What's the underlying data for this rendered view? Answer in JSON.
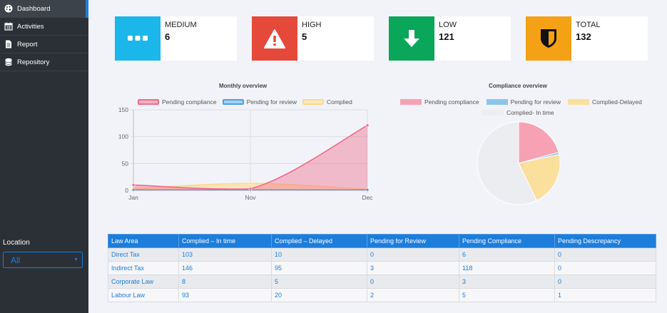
{
  "sidebar": {
    "items": [
      {
        "label": "Dashboard",
        "icon": "palette-icon",
        "active": true
      },
      {
        "label": "Activities",
        "icon": "calendar-icon",
        "active": false
      },
      {
        "label": "Report",
        "icon": "document-icon",
        "active": false
      },
      {
        "label": "Repository",
        "icon": "database-icon",
        "active": false
      }
    ],
    "location_label": "Location",
    "location_value": "All"
  },
  "cards": [
    {
      "label": "MEDIUM",
      "value": "6",
      "color": "#1bb7ea",
      "icon": "ellipsis-icon"
    },
    {
      "label": "HIGH",
      "value": "5",
      "color": "#e5493a",
      "icon": "warning-icon"
    },
    {
      "label": "LOW",
      "value": "121",
      "color": "#0aa65a",
      "icon": "arrow-down-icon"
    },
    {
      "label": "TOTAL",
      "value": "132",
      "color": "#f4a115",
      "icon": "shield-icon"
    }
  ],
  "monthly": {
    "title": "Monthly overview",
    "legend": [
      {
        "label": "Pending compliance",
        "color": "#f06b8c"
      },
      {
        "label": "Pending for review",
        "color": "#4aa1e6"
      },
      {
        "label": "Complied",
        "color": "#fcd98a"
      }
    ]
  },
  "compliance": {
    "title": "Compliance overview",
    "legend": [
      {
        "label": "Pending compliance",
        "color": "#f7a1b5"
      },
      {
        "label": "Pending for review",
        "color": "#8cc4ec"
      },
      {
        "label": "Complied-Delayed",
        "color": "#fadf9d"
      },
      {
        "label": "Complied- In time",
        "color": "#ebedf1"
      }
    ]
  },
  "chart_data": [
    {
      "type": "area",
      "title": "Monthly overview",
      "x": [
        "Jan",
        "Nov",
        "Dec"
      ],
      "ylim": [
        0,
        150
      ],
      "yticks": [
        0,
        50,
        100,
        150
      ],
      "grid": true,
      "legend_position": "top",
      "series": [
        {
          "name": "Pending compliance",
          "values": [
            10,
            3,
            121
          ],
          "color": "#f06b8c"
        },
        {
          "name": "Pending for review",
          "values": [
            1,
            1,
            1
          ],
          "color": "#4aa1e6"
        },
        {
          "name": "Complied",
          "values": [
            3,
            13,
            2
          ],
          "color": "#fcd98a"
        }
      ]
    },
    {
      "type": "pie",
      "title": "Compliance overview",
      "legend_position": "top",
      "categories": [
        "Pending compliance",
        "Pending for review",
        "Complied-Delayed",
        "Complied- In time"
      ],
      "values": [
        127,
        5,
        130,
        350
      ],
      "colors": [
        "#f7a1b5",
        "#8cc4ec",
        "#fadf9d",
        "#ebedf1"
      ]
    }
  ],
  "table": {
    "headers": [
      "Law Area",
      "Complied – In time",
      "Complied – Delayed",
      "Pending for Review",
      "Pending Compliance",
      "Pending Descrepancy"
    ],
    "rows": [
      [
        "Direct Tax",
        "103",
        "10",
        "0",
        "6",
        "0"
      ],
      [
        "Indirect Tax",
        "146",
        "95",
        "3",
        "118",
        "0"
      ],
      [
        "Corporate Law",
        "8",
        "5",
        "0",
        "3",
        "0"
      ],
      [
        "Labour Law",
        "93",
        "20",
        "2",
        "5",
        "1"
      ]
    ]
  }
}
